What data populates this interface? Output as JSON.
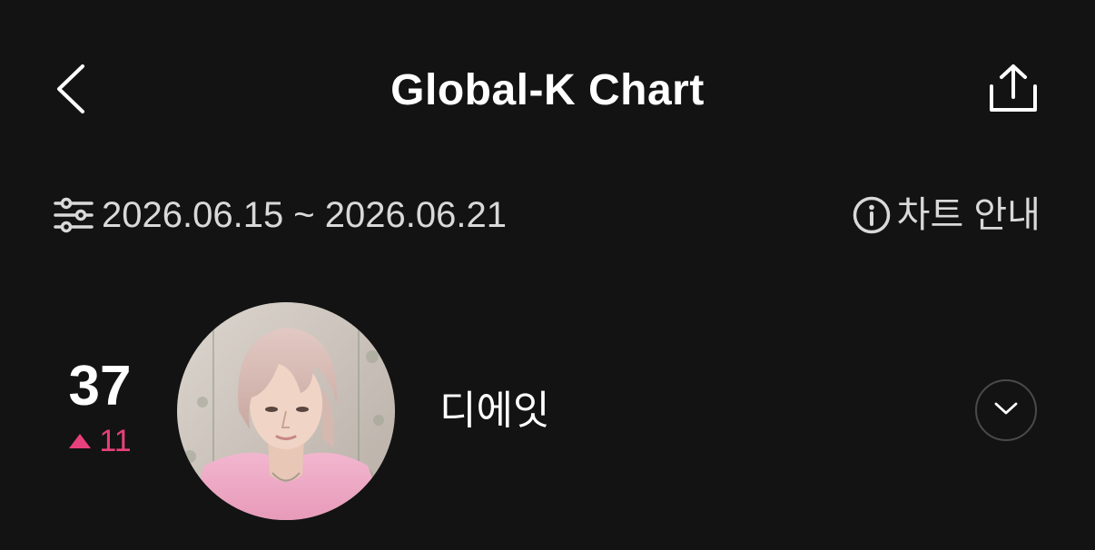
{
  "header": {
    "title": "Global-K Chart",
    "back_icon": "chevron-left-icon",
    "share_icon": "share-icon"
  },
  "filter": {
    "date_range": "2026.06.15 ~ 2026.06.21",
    "filter_icon": "sliders-icon",
    "guide_label": "차트 안내",
    "guide_icon": "info-icon"
  },
  "chart_item": {
    "rank": "37",
    "rank_change": "11",
    "rank_change_direction": "up",
    "artist_name": "디에잇",
    "expand_icon": "chevron-down-icon"
  },
  "colors": {
    "background": "#131313",
    "text_primary": "#ffffff",
    "text_secondary": "#d9d9d9",
    "rank_up": "#e8407a",
    "button_border": "#4a4a4a"
  }
}
